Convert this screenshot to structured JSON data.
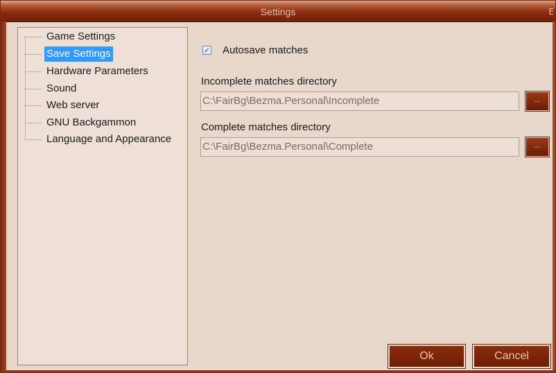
{
  "window": {
    "title": "Settings",
    "close_glyph": "E"
  },
  "tree": {
    "items": [
      {
        "label": "Game Settings",
        "selected": false
      },
      {
        "label": "Save Settings",
        "selected": true
      },
      {
        "label": "Hardware Parameters",
        "selected": false
      },
      {
        "label": "Sound",
        "selected": false
      },
      {
        "label": "Web server",
        "selected": false
      },
      {
        "label": "GNU Backgammon",
        "selected": false
      },
      {
        "label": "Language and Appearance",
        "selected": false
      }
    ]
  },
  "save_settings": {
    "autosave": {
      "label": "Autosave matches",
      "checked": true,
      "check_glyph": "✓"
    },
    "incomplete": {
      "label": "Incomplete matches directory",
      "value": "C:\\FairBg\\Bezma.Personal\\Incomplete",
      "browse_label": "..."
    },
    "complete": {
      "label": "Complete matches directory",
      "value": "C:\\FairBg\\Bezma.Personal\\Complete",
      "browse_label": "..."
    }
  },
  "buttons": {
    "ok": "Ok",
    "cancel": "Cancel"
  },
  "colors": {
    "accent": "#8a2c10",
    "selection": "#3399ff",
    "dialog_bg": "#e8d8cc"
  }
}
